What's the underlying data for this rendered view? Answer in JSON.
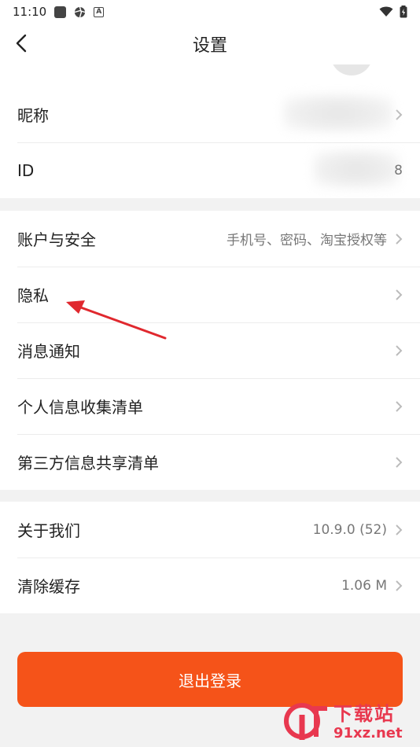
{
  "status_bar": {
    "time": "11:10"
  },
  "nav": {
    "title": "设置"
  },
  "profile": {
    "rows": [
      {
        "label": "昵称",
        "value": ""
      },
      {
        "label": "ID",
        "value": "8"
      }
    ]
  },
  "account": {
    "rows": [
      {
        "label": "账户与安全",
        "value": "手机号、密码、淘宝授权等"
      },
      {
        "label": "隐私",
        "value": ""
      },
      {
        "label": "消息通知",
        "value": ""
      },
      {
        "label": "个人信息收集清单",
        "value": ""
      },
      {
        "label": "第三方信息共享清单",
        "value": ""
      }
    ]
  },
  "about": {
    "rows": [
      {
        "label": "关于我们",
        "value": "10.9.0 (52)"
      },
      {
        "label": "清除缓存",
        "value": "1.06 M"
      }
    ]
  },
  "logout": {
    "label": "退出登录"
  },
  "watermark": {
    "title": "下载站",
    "site": "91xz.net",
    "logo_text": "9f"
  },
  "colors": {
    "accent": "#f55319",
    "annotation": "#e0282e",
    "watermark": "#e8384f"
  }
}
